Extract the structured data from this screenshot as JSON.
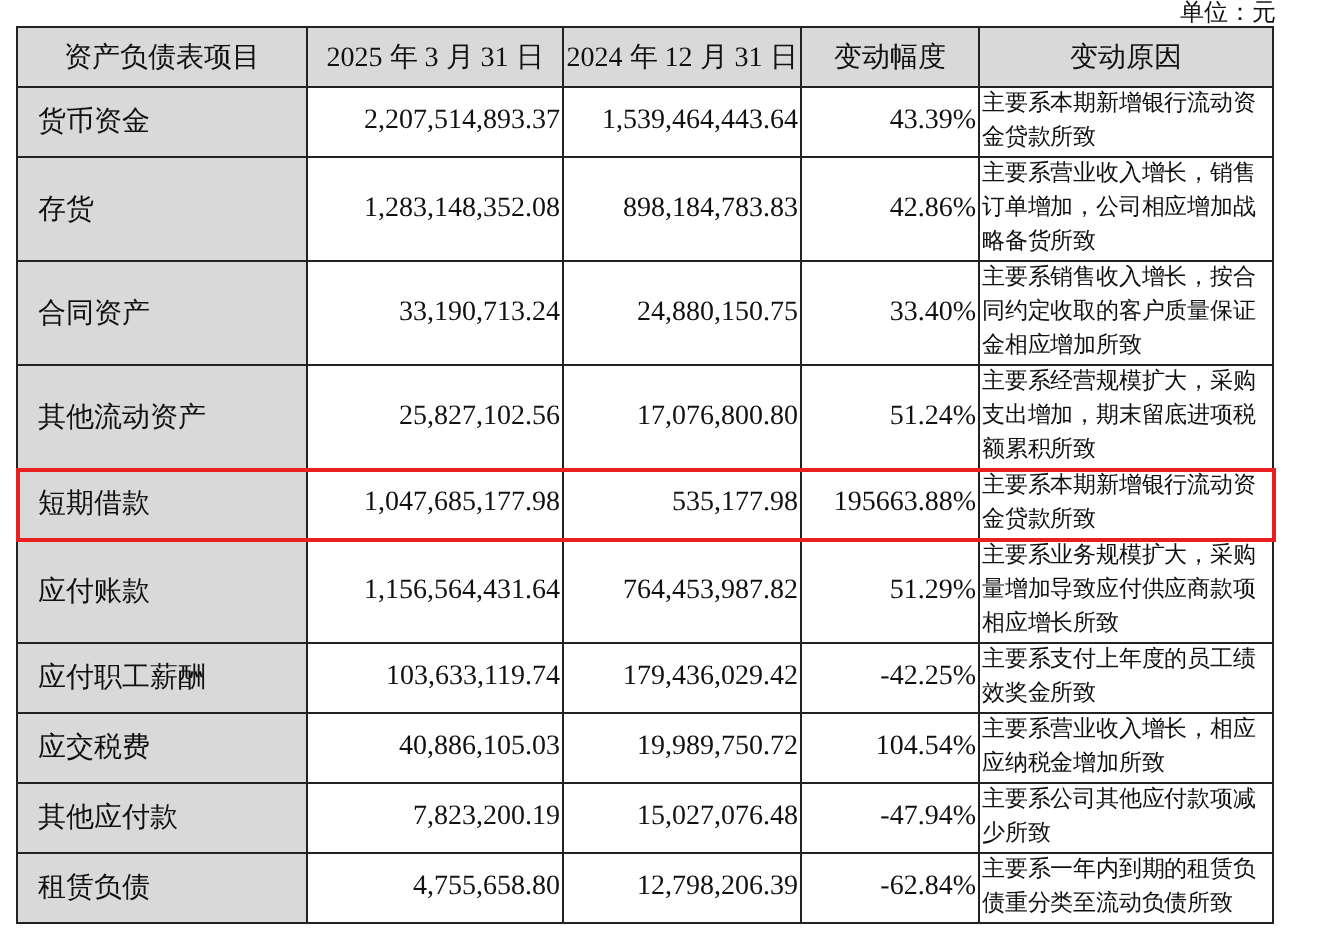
{
  "unit": "单位：元",
  "table": {
    "columns": [
      "资产负债表项目",
      "2025 年 3 月 31 日",
      "2024 年 12 月 31 日",
      "变动幅度",
      "变动原因"
    ],
    "rows": [
      {
        "item": "货币资金",
        "current": "2,207,514,893.37",
        "previous": "1,539,464,443.64",
        "change": "43.39%",
        "reason": "主要系本期新增银行流动资金贷款所致",
        "highlighted": false
      },
      {
        "item": "存货",
        "current": "1,283,148,352.08",
        "previous": "898,184,783.83",
        "change": "42.86%",
        "reason": "主要系营业收入增长，销售订单增加，公司相应增加战略备货所致",
        "highlighted": false
      },
      {
        "item": "合同资产",
        "current": "33,190,713.24",
        "previous": "24,880,150.75",
        "change": "33.40%",
        "reason": "主要系销售收入增长，按合同约定收取的客户质量保证金相应增加所致",
        "highlighted": false
      },
      {
        "item": "其他流动资产",
        "current": "25,827,102.56",
        "previous": "17,076,800.80",
        "change": "51.24%",
        "reason": "主要系经营规模扩大，采购支出增加，期末留底进项税额累积所致",
        "highlighted": false
      },
      {
        "item": "短期借款",
        "current": "1,047,685,177.98",
        "previous": "535,177.98",
        "change": "195663.88%",
        "reason": "主要系本期新增银行流动资金贷款所致",
        "highlighted": true
      },
      {
        "item": "应付账款",
        "current": "1,156,564,431.64",
        "previous": "764,453,987.82",
        "change": "51.29%",
        "reason": "主要系业务规模扩大，采购量增加导致应付供应商款项相应增长所致",
        "highlighted": false
      },
      {
        "item": "应付职工薪酬",
        "current": "103,633,119.74",
        "previous": "179,436,029.42",
        "change": "-42.25%",
        "reason": "主要系支付上年度的员工绩效奖金所致",
        "highlighted": false
      },
      {
        "item": "应交税费",
        "current": "40,886,105.03",
        "previous": "19,989,750.72",
        "change": "104.54%",
        "reason": "主要系营业收入增长，相应应纳税金增加所致",
        "highlighted": false
      },
      {
        "item": "其他应付款",
        "current": "7,823,200.19",
        "previous": "15,027,076.48",
        "change": "-47.94%",
        "reason": "主要系公司其他应付款项减少所致",
        "highlighted": false
      },
      {
        "item": "租赁负债",
        "current": "4,755,658.80",
        "previous": "12,798,206.39",
        "change": "-62.84%",
        "reason": "主要系一年内到期的租赁负债重分类至流动负债所致",
        "highlighted": false
      }
    ]
  }
}
